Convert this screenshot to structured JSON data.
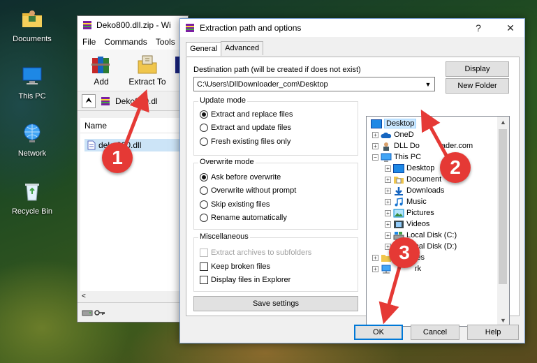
{
  "desktop": {
    "icons": [
      {
        "label": "Documents",
        "icon": "folder-user-icon"
      },
      {
        "label": "This PC",
        "icon": "computer-icon"
      },
      {
        "label": "Network",
        "icon": "network-globe-icon"
      },
      {
        "label": "Recycle Bin",
        "icon": "recycle-bin-icon"
      }
    ]
  },
  "winrar": {
    "title": "Deko800.dll.zip - Wi",
    "menu": [
      "File",
      "Commands",
      "Tools"
    ],
    "toolbar": {
      "add": "Add",
      "extract_to": "Extract To"
    },
    "path": "Deko800.dl",
    "list_header": "Name",
    "file": "deko800.dll",
    "scroll_left": "<"
  },
  "dialog": {
    "title": "Extraction path and options",
    "help": "?",
    "close": "✕",
    "tabs": [
      "General",
      "Advanced"
    ],
    "dest_label": "Destination path (will be created if does not exist)",
    "dest_value": "C:\\Users\\DllDownloader_com\\Desktop",
    "display_button": "Display",
    "new_folder_button": "New Folder",
    "update_mode": {
      "title": "Update mode",
      "options": [
        "Extract and replace files",
        "Extract and update files",
        "Fresh existing files only"
      ],
      "selected": 0
    },
    "overwrite_mode": {
      "title": "Overwrite mode",
      "options": [
        "Ask before overwrite",
        "Overwrite without prompt",
        "Skip existing files",
        "Rename automatically"
      ],
      "selected": 0
    },
    "misc": {
      "title": "Miscellaneous",
      "options": [
        "Extract archives to subfolders",
        "Keep broken files",
        "Display files in Explorer"
      ]
    },
    "save_settings": "Save settings",
    "tree": [
      {
        "label": "Desktop",
        "level": 0,
        "selected": true
      },
      {
        "label": "OneD",
        "level": 1
      },
      {
        "label": "DLL Do",
        "label_tail": "ader.com",
        "level": 1
      },
      {
        "label": "This PC",
        "level": 1
      },
      {
        "label": "Desktop",
        "level": 2
      },
      {
        "label": "Document",
        "level": 2
      },
      {
        "label": "Downloads",
        "level": 2
      },
      {
        "label": "Music",
        "level": 2
      },
      {
        "label": "Pictures",
        "level": 2
      },
      {
        "label": "Videos",
        "level": 2
      },
      {
        "label": "Local Disk (C:)",
        "level": 2
      },
      {
        "label": "Local Disk (D:)",
        "level": 2
      },
      {
        "label": "ies",
        "level": 1
      },
      {
        "label": "rk",
        "level": 1
      }
    ],
    "ok": "OK",
    "cancel": "Cancel",
    "help_button": "Help"
  },
  "annotations": {
    "step1": "1",
    "step2": "2",
    "step3": "3",
    "color": "#e53935"
  }
}
